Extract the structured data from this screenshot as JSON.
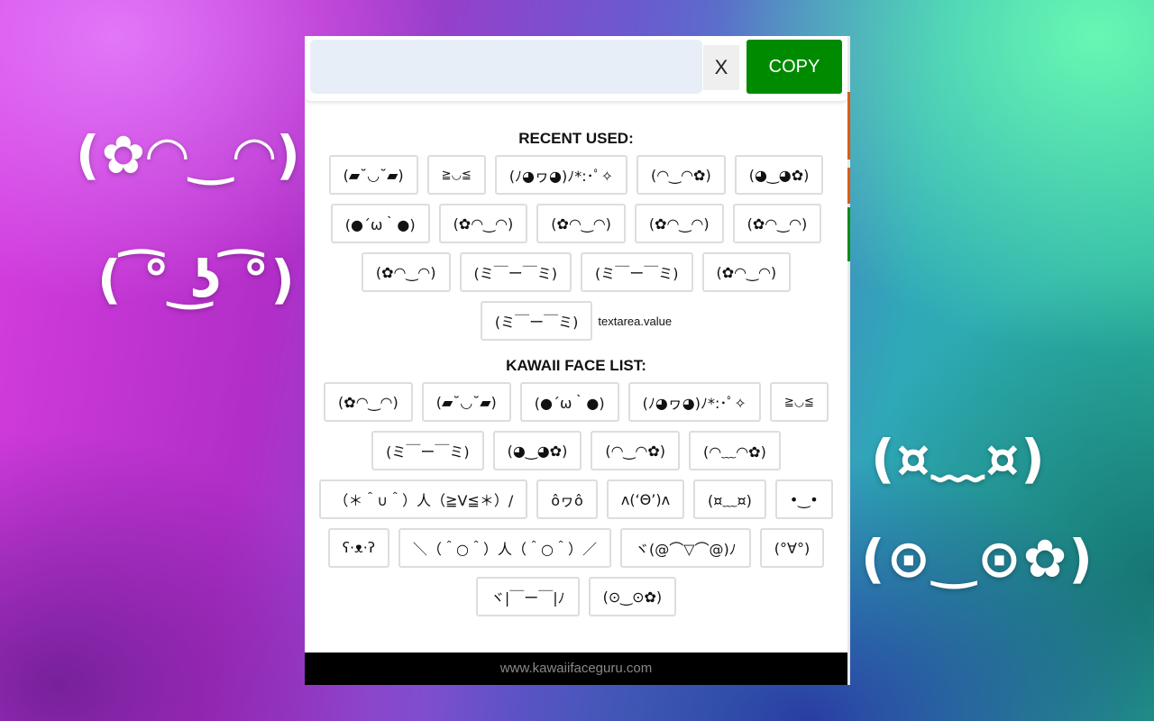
{
  "background_decor": {
    "faces": [
      "(✿◠‿◠)",
      "( ͡° ͜ʖ ͡°)",
      "(¤﹏¤)",
      "(⊙‿⊙✿)"
    ]
  },
  "topbar": {
    "input_value": "",
    "input_placeholder": "",
    "clear_label": "X",
    "copy_label": "COPY",
    "copy_color": "#008a00"
  },
  "recent": {
    "title": "RECENT USED:",
    "items": [
      "(▰˘◡˘▰)",
      "≧◡≦",
      "(ﾉ◕ヮ◕)ﾉ*:･ﾟ✧",
      "(◠‿◠✿)",
      "(◕‿◕✿)",
      "(●´ω｀●)",
      "(✿◠‿◠)",
      "(✿◠‿◠)",
      "(✿◠‿◠)",
      "(✿◠‿◠)",
      "(✿◠‿◠)",
      "(ミ￣ー￣ミ)",
      "(ミ￣ー￣ミ)",
      "(✿◠‿◠)",
      "(ミ￣ー￣ミ)"
    ],
    "note": "textarea.value"
  },
  "kawaii": {
    "title": "KAWAII FACE LIST:",
    "items": [
      "(✿◠‿◠)",
      "(▰˘◡˘▰)",
      "(●´ω｀●)",
      "(ﾉ◕ヮ◕)ﾉ*:･ﾟ✧",
      "≧◡≦",
      "(ミ￣ー￣ミ)",
      "(◕‿◕✿)",
      "(◠‿◠✿)",
      "(◠﹏◠✿)",
      "（＊＾∪＾）人（≧V≦＊）/",
      "ôヮô",
      "ʌ(‘Θ’)ʌ",
      "(¤﹏¤)",
      "•‿•",
      "ʕ·ᴥ·ʔ",
      "＼（＾○＾）人（＾○＾）／",
      "ヾ(@⌒▽⌒@)ﾉ",
      "(°∀°)",
      "ヾ|￣ー￣|ﾉ",
      "(⊙‿⊙✿)"
    ]
  },
  "footer": {
    "text": "www.kawaiifaceguru.com"
  }
}
